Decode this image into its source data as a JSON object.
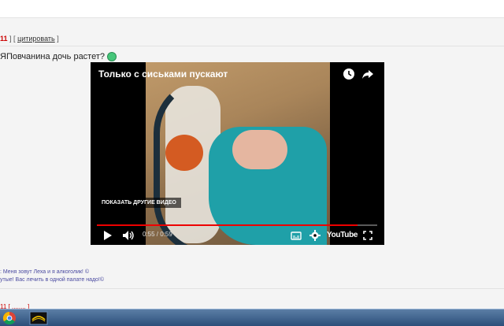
{
  "post": {
    "number_fragment": "11",
    "quote_link": "цитировать",
    "question_text": "ЯПовчанина дочь растет?",
    "bracket_open": "]  [",
    "bracket_close": "]"
  },
  "video": {
    "title": "Только с сиськами пускают",
    "more_videos_label": "ПОКАЗАТЬ ДРУГИЕ ВИДЕО",
    "time_display": "0:55 / 0:59",
    "progress": 0.93,
    "brand": "YouTube"
  },
  "footer_quotes": {
    "line1": ": Меня зовут Леха и я алкоголик! ©",
    "line2": "утые! Вас лечить в одной палате надо!©"
  },
  "lower_post": {
    "fragment": "11 [ ........ ]"
  },
  "colors": {
    "accent_red": "#cc0000",
    "youtube_red": "#ee0000",
    "link_blue": "#4a4aa0"
  },
  "icons": [
    "clock-icon",
    "share-icon",
    "play-icon",
    "volume-icon",
    "subtitles-icon",
    "settings-icon",
    "fullscreen-icon",
    "chrome-icon",
    "app-icon"
  ]
}
